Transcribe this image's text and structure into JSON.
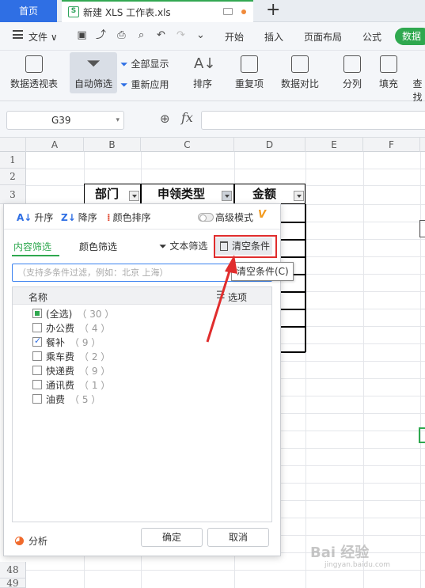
{
  "tabs": {
    "home": "首页",
    "file": "新建 XLS 工作表.xls",
    "add": "+"
  },
  "menu": {
    "file": "文件 ∨",
    "tabs": [
      "开始",
      "插入",
      "页面布局",
      "公式"
    ],
    "active_tab": "数据"
  },
  "ribbon": {
    "pivot": "数据透视表",
    "autofilter": "自动筛选",
    "show_all": "全部显示",
    "reapply": "重新应用",
    "sort": "排序",
    "dup": "重复项",
    "compare": "数据对比",
    "split": "分列",
    "fill": "填充",
    "lookup": "查找"
  },
  "formula": {
    "cell": "G39",
    "fx": "fx"
  },
  "columns": [
    "A",
    "B",
    "C",
    "D",
    "E",
    "F"
  ],
  "rows": [
    "1",
    "2",
    "3",
    "48",
    "49"
  ],
  "table_headers": [
    "部门",
    "申领类型",
    "金额"
  ],
  "filter_popup": {
    "asc": "升序",
    "desc": "降序",
    "color_sort": "颜色排序",
    "advanced": "高级模式",
    "vip": "V",
    "tab_content": "内容筛选",
    "tab_color": "颜色筛选",
    "text_filter": "文本筛选",
    "clear": "清空条件",
    "search_placeholder": "（支持多条件过滤，例如：北京  上海）",
    "list_name": "名称",
    "list_options": "选项",
    "items": [
      {
        "label": "(全选)",
        "count": "（ 30 ）",
        "state": "partial"
      },
      {
        "label": "办公费",
        "count": "（ 4 ）",
        "state": "unchecked"
      },
      {
        "label": "餐补",
        "count": "（ 9 ）",
        "state": "checked"
      },
      {
        "label": "乘车费",
        "count": "（ 2 ）",
        "state": "unchecked"
      },
      {
        "label": "快递费",
        "count": "（ 9 ）",
        "state": "unchecked"
      },
      {
        "label": "通讯费",
        "count": "（ 1 ）",
        "state": "unchecked"
      },
      {
        "label": "油费",
        "count": "（ 5 ）",
        "state": "unchecked"
      }
    ],
    "analysis": "分析",
    "ok": "确定",
    "cancel": "取消"
  },
  "tooltip": "清空条件(C)",
  "watermark": {
    "main": "Bai 经验",
    "sub": "jingyan.baidu.com"
  },
  "colors": {
    "accent_green": "#2fa84f",
    "home_blue": "#2f6fe4",
    "annotation_red": "#e02d2d"
  }
}
